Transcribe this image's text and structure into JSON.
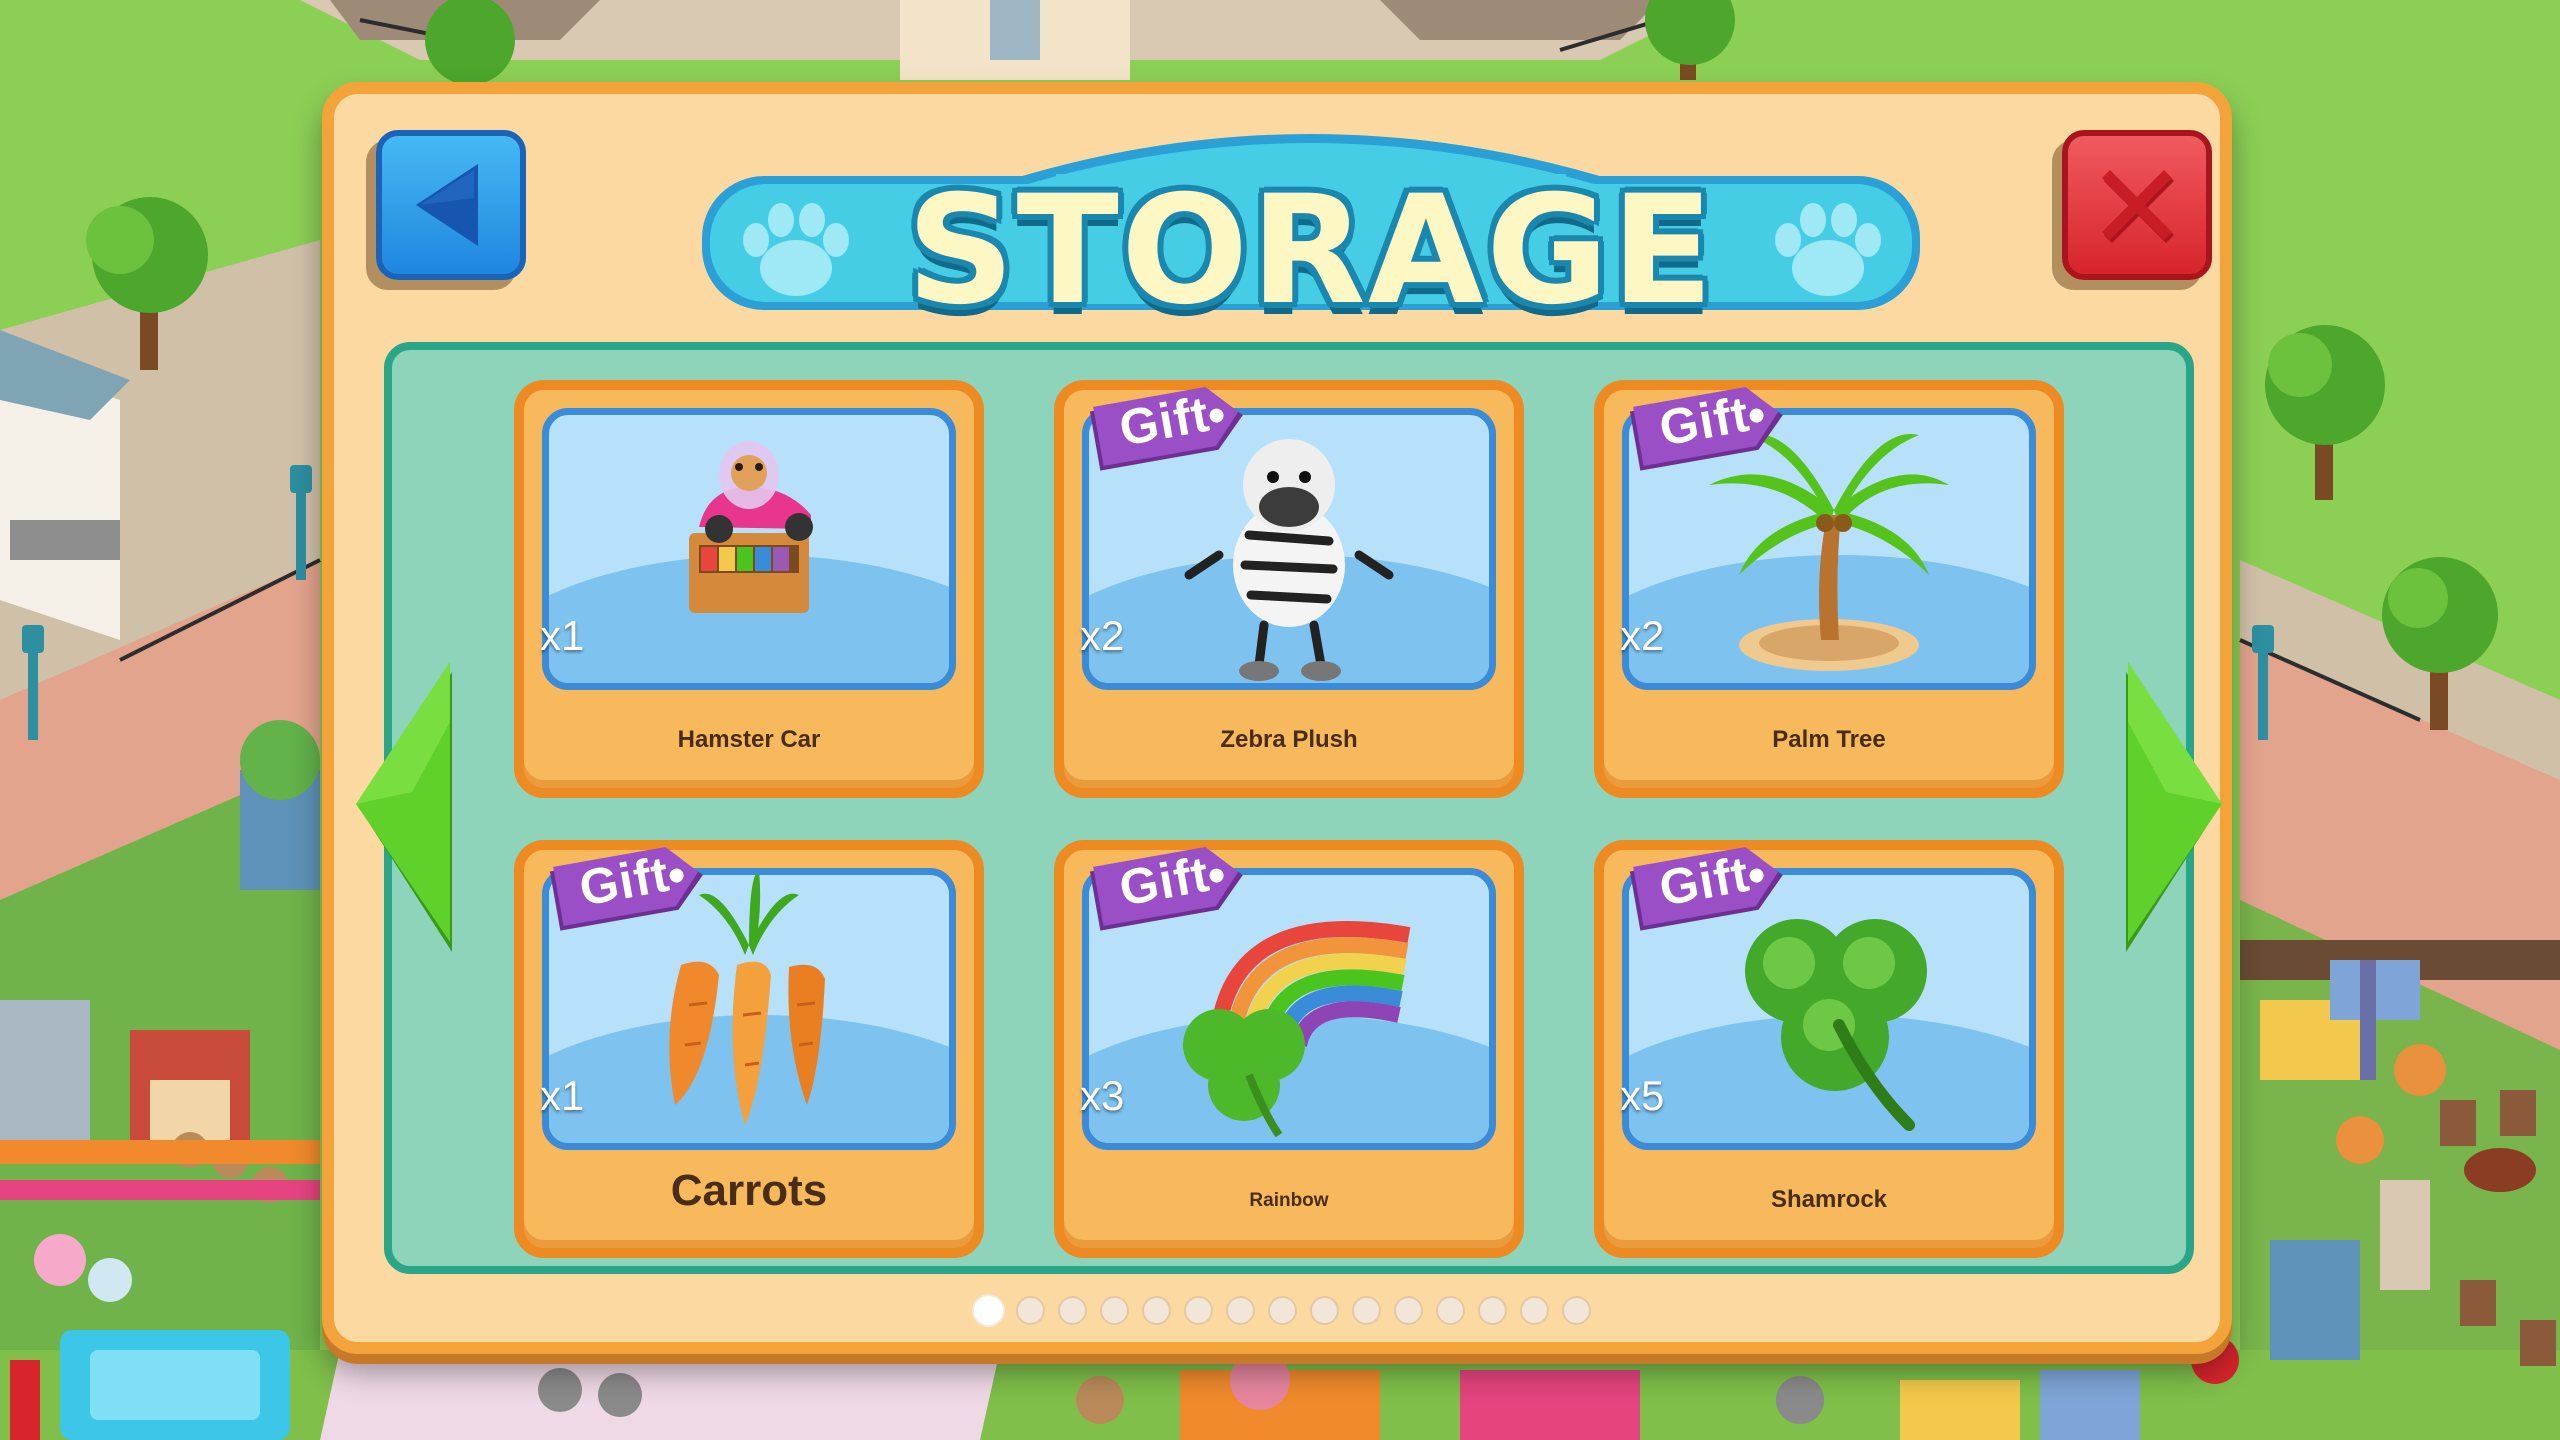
{
  "dialog": {
    "title": "STORAGE",
    "back_icon": "back-arrow-icon",
    "close_icon": "close-x-icon"
  },
  "items": [
    {
      "name": "Hamster Car",
      "quantity": "x1",
      "gift": "",
      "icon": "hamster-car-icon"
    },
    {
      "name": "Zebra Plush",
      "quantity": "x2",
      "gift": "Gift",
      "icon": "zebra-plush-icon"
    },
    {
      "name": "Palm Tree",
      "quantity": "x2",
      "gift": "Gift",
      "icon": "palm-tree-icon"
    },
    {
      "name": "Carrots",
      "quantity": "x1",
      "gift": "Gift",
      "icon": "carrots-icon"
    },
    {
      "name": "Rainbow",
      "quantity": "x3",
      "gift": "Gift",
      "icon": "rainbow-icon"
    },
    {
      "name": "Shamrock",
      "quantity": "x5",
      "gift": "Gift",
      "icon": "shamrock-icon"
    }
  ],
  "navigation": {
    "prev_icon": "left-arrow-icon",
    "next_icon": "right-arrow-icon"
  },
  "pagination": {
    "total_pages": 15,
    "current_page": 1
  },
  "colors": {
    "dialog_fill": "#fbd9a1",
    "dialog_border": "#f2a43a",
    "panel_fill": "#8ed4ba",
    "card_fill": "#f7b95b",
    "gift_tag": "#8e44b5",
    "close_button": "#d8242c",
    "back_button": "#1f86e0",
    "arrow_green": "#4cc41e"
  }
}
